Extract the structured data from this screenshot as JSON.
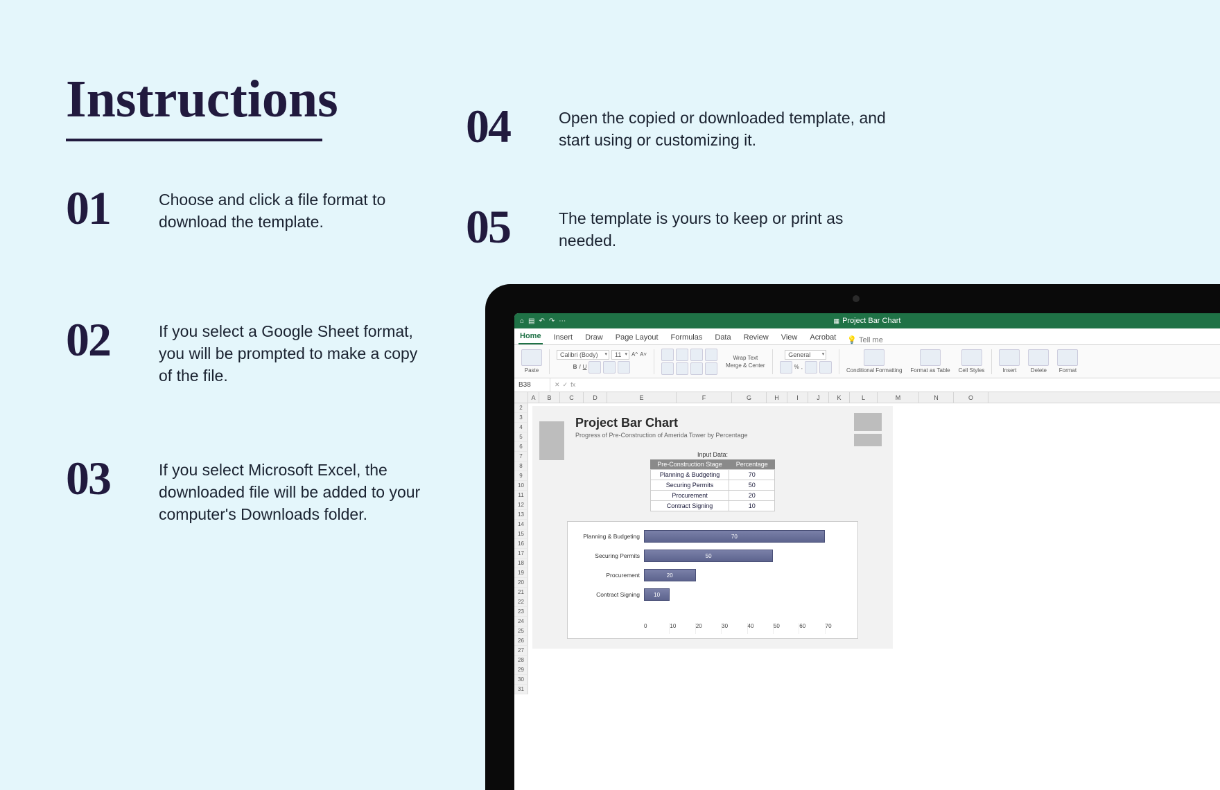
{
  "title": "Instructions",
  "steps": [
    {
      "num": "01",
      "text": "Choose and click a file format to download the template."
    },
    {
      "num": "02",
      "text": "If you select a Google Sheet format, you will be prompted to make a copy of the file."
    },
    {
      "num": "03",
      "text": "If you select Microsoft Excel, the downloaded file will be added to your computer's Downloads folder."
    },
    {
      "num": "04",
      "text": "Open the copied or downloaded template, and start using or customizing it."
    },
    {
      "num": "05",
      "text": "The template is yours to keep or print as needed."
    }
  ],
  "excel": {
    "window_title": "Project Bar Chart",
    "tabs": [
      "Home",
      "Insert",
      "Draw",
      "Page Layout",
      "Formulas",
      "Data",
      "Review",
      "View",
      "Acrobat"
    ],
    "active_tab": "Home",
    "tell_me": "Tell me",
    "ribbon": {
      "paste": "Paste",
      "font_name": "Calibri (Body)",
      "font_size": "11",
      "wrap": "Wrap Text",
      "merge": "Merge & Center",
      "number_format": "General",
      "cond": "Conditional Formatting",
      "fat": "Format as Table",
      "styles": "Cell Styles",
      "insert": "Insert",
      "delete": "Delete",
      "format": "Format"
    },
    "namebox": "B38",
    "fx": "fx",
    "columns": [
      "A",
      "B",
      "C",
      "D",
      "E",
      "F",
      "G",
      "H",
      "I",
      "J",
      "K",
      "L",
      "M",
      "N",
      "O"
    ],
    "rows_start": 2,
    "rows_end": 31,
    "doc": {
      "title": "Project Bar Chart",
      "subtitle": "Progress of Pre-Construction of Amerida Tower by Percentage",
      "input_label": "Input Data:",
      "th1": "Pre-Construction Stage",
      "th2": "Percentage"
    }
  },
  "chart_data": {
    "type": "bar",
    "title": "Project Bar Chart",
    "xlabel": "",
    "ylabel": "",
    "xlim": [
      0,
      80
    ],
    "xticks": [
      0,
      10,
      20,
      30,
      40,
      50,
      60,
      70
    ],
    "categories": [
      "Planning & Budgeting",
      "Securing Permits",
      "Procurement",
      "Contract Signing"
    ],
    "values": [
      70,
      50,
      20,
      10
    ]
  }
}
